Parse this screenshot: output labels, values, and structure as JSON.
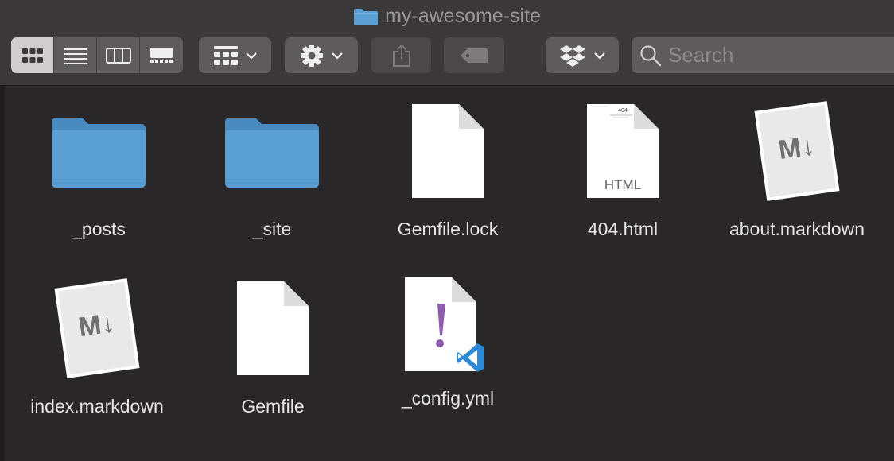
{
  "window": {
    "title": "my-awesome-site",
    "title_icon": "folder-icon"
  },
  "toolbar": {
    "view_modes": [
      {
        "name": "icon-view",
        "icon": "grid-icon",
        "active": true
      },
      {
        "name": "list-view",
        "icon": "list-icon",
        "active": false
      },
      {
        "name": "column-view",
        "icon": "columns-icon",
        "active": false
      },
      {
        "name": "gallery-view",
        "icon": "gallery-icon",
        "active": false
      }
    ],
    "group_button_icon": "grid-group-icon",
    "action_button_icon": "gear-icon",
    "share_button_icon": "share-icon",
    "tag_button_icon": "tag-icon",
    "dropbox_button_icon": "dropbox-icon",
    "search": {
      "placeholder": "Search",
      "value": ""
    }
  },
  "files": [
    {
      "name": "_posts",
      "type": "folder"
    },
    {
      "name": "_site",
      "type": "folder"
    },
    {
      "name": "Gemfile.lock",
      "type": "document"
    },
    {
      "name": "404.html",
      "type": "html",
      "badge": "HTML"
    },
    {
      "name": "about.markdown",
      "type": "markdown"
    },
    {
      "name": "index.markdown",
      "type": "markdown"
    },
    {
      "name": "Gemfile",
      "type": "document"
    },
    {
      "name": "_config.yml",
      "type": "yaml"
    }
  ],
  "colors": {
    "background": "#2a2728",
    "toolbar": "#3a3839",
    "folder": "#5ba0d4",
    "yaml_accent": "#8e5bb0",
    "vscode_blue": "#2a8ad8"
  }
}
